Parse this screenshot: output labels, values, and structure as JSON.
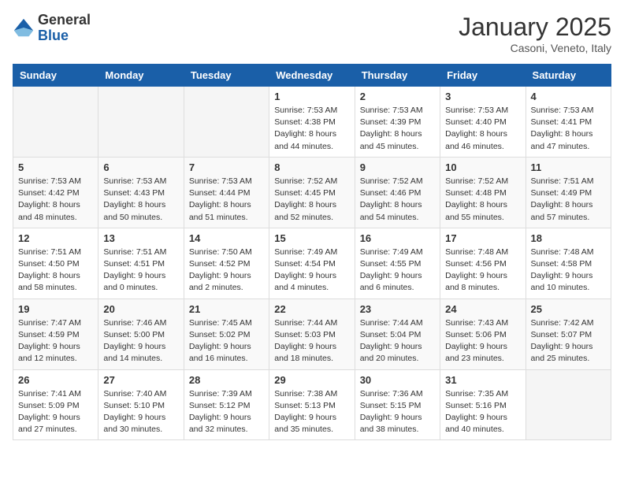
{
  "logo": {
    "general": "General",
    "blue": "Blue"
  },
  "header": {
    "month": "January 2025",
    "location": "Casoni, Veneto, Italy"
  },
  "weekdays": [
    "Sunday",
    "Monday",
    "Tuesday",
    "Wednesday",
    "Thursday",
    "Friday",
    "Saturday"
  ],
  "weeks": [
    [
      {
        "day": "",
        "sunrise": "",
        "sunset": "",
        "daylight": ""
      },
      {
        "day": "",
        "sunrise": "",
        "sunset": "",
        "daylight": ""
      },
      {
        "day": "",
        "sunrise": "",
        "sunset": "",
        "daylight": ""
      },
      {
        "day": "1",
        "sunrise": "Sunrise: 7:53 AM",
        "sunset": "Sunset: 4:38 PM",
        "daylight": "Daylight: 8 hours and 44 minutes."
      },
      {
        "day": "2",
        "sunrise": "Sunrise: 7:53 AM",
        "sunset": "Sunset: 4:39 PM",
        "daylight": "Daylight: 8 hours and 45 minutes."
      },
      {
        "day": "3",
        "sunrise": "Sunrise: 7:53 AM",
        "sunset": "Sunset: 4:40 PM",
        "daylight": "Daylight: 8 hours and 46 minutes."
      },
      {
        "day": "4",
        "sunrise": "Sunrise: 7:53 AM",
        "sunset": "Sunset: 4:41 PM",
        "daylight": "Daylight: 8 hours and 47 minutes."
      }
    ],
    [
      {
        "day": "5",
        "sunrise": "Sunrise: 7:53 AM",
        "sunset": "Sunset: 4:42 PM",
        "daylight": "Daylight: 8 hours and 48 minutes."
      },
      {
        "day": "6",
        "sunrise": "Sunrise: 7:53 AM",
        "sunset": "Sunset: 4:43 PM",
        "daylight": "Daylight: 8 hours and 50 minutes."
      },
      {
        "day": "7",
        "sunrise": "Sunrise: 7:53 AM",
        "sunset": "Sunset: 4:44 PM",
        "daylight": "Daylight: 8 hours and 51 minutes."
      },
      {
        "day": "8",
        "sunrise": "Sunrise: 7:52 AM",
        "sunset": "Sunset: 4:45 PM",
        "daylight": "Daylight: 8 hours and 52 minutes."
      },
      {
        "day": "9",
        "sunrise": "Sunrise: 7:52 AM",
        "sunset": "Sunset: 4:46 PM",
        "daylight": "Daylight: 8 hours and 54 minutes."
      },
      {
        "day": "10",
        "sunrise": "Sunrise: 7:52 AM",
        "sunset": "Sunset: 4:48 PM",
        "daylight": "Daylight: 8 hours and 55 minutes."
      },
      {
        "day": "11",
        "sunrise": "Sunrise: 7:51 AM",
        "sunset": "Sunset: 4:49 PM",
        "daylight": "Daylight: 8 hours and 57 minutes."
      }
    ],
    [
      {
        "day": "12",
        "sunrise": "Sunrise: 7:51 AM",
        "sunset": "Sunset: 4:50 PM",
        "daylight": "Daylight: 8 hours and 58 minutes."
      },
      {
        "day": "13",
        "sunrise": "Sunrise: 7:51 AM",
        "sunset": "Sunset: 4:51 PM",
        "daylight": "Daylight: 9 hours and 0 minutes."
      },
      {
        "day": "14",
        "sunrise": "Sunrise: 7:50 AM",
        "sunset": "Sunset: 4:52 PM",
        "daylight": "Daylight: 9 hours and 2 minutes."
      },
      {
        "day": "15",
        "sunrise": "Sunrise: 7:49 AM",
        "sunset": "Sunset: 4:54 PM",
        "daylight": "Daylight: 9 hours and 4 minutes."
      },
      {
        "day": "16",
        "sunrise": "Sunrise: 7:49 AM",
        "sunset": "Sunset: 4:55 PM",
        "daylight": "Daylight: 9 hours and 6 minutes."
      },
      {
        "day": "17",
        "sunrise": "Sunrise: 7:48 AM",
        "sunset": "Sunset: 4:56 PM",
        "daylight": "Daylight: 9 hours and 8 minutes."
      },
      {
        "day": "18",
        "sunrise": "Sunrise: 7:48 AM",
        "sunset": "Sunset: 4:58 PM",
        "daylight": "Daylight: 9 hours and 10 minutes."
      }
    ],
    [
      {
        "day": "19",
        "sunrise": "Sunrise: 7:47 AM",
        "sunset": "Sunset: 4:59 PM",
        "daylight": "Daylight: 9 hours and 12 minutes."
      },
      {
        "day": "20",
        "sunrise": "Sunrise: 7:46 AM",
        "sunset": "Sunset: 5:00 PM",
        "daylight": "Daylight: 9 hours and 14 minutes."
      },
      {
        "day": "21",
        "sunrise": "Sunrise: 7:45 AM",
        "sunset": "Sunset: 5:02 PM",
        "daylight": "Daylight: 9 hours and 16 minutes."
      },
      {
        "day": "22",
        "sunrise": "Sunrise: 7:44 AM",
        "sunset": "Sunset: 5:03 PM",
        "daylight": "Daylight: 9 hours and 18 minutes."
      },
      {
        "day": "23",
        "sunrise": "Sunrise: 7:44 AM",
        "sunset": "Sunset: 5:04 PM",
        "daylight": "Daylight: 9 hours and 20 minutes."
      },
      {
        "day": "24",
        "sunrise": "Sunrise: 7:43 AM",
        "sunset": "Sunset: 5:06 PM",
        "daylight": "Daylight: 9 hours and 23 minutes."
      },
      {
        "day": "25",
        "sunrise": "Sunrise: 7:42 AM",
        "sunset": "Sunset: 5:07 PM",
        "daylight": "Daylight: 9 hours and 25 minutes."
      }
    ],
    [
      {
        "day": "26",
        "sunrise": "Sunrise: 7:41 AM",
        "sunset": "Sunset: 5:09 PM",
        "daylight": "Daylight: 9 hours and 27 minutes."
      },
      {
        "day": "27",
        "sunrise": "Sunrise: 7:40 AM",
        "sunset": "Sunset: 5:10 PM",
        "daylight": "Daylight: 9 hours and 30 minutes."
      },
      {
        "day": "28",
        "sunrise": "Sunrise: 7:39 AM",
        "sunset": "Sunset: 5:12 PM",
        "daylight": "Daylight: 9 hours and 32 minutes."
      },
      {
        "day": "29",
        "sunrise": "Sunrise: 7:38 AM",
        "sunset": "Sunset: 5:13 PM",
        "daylight": "Daylight: 9 hours and 35 minutes."
      },
      {
        "day": "30",
        "sunrise": "Sunrise: 7:36 AM",
        "sunset": "Sunset: 5:15 PM",
        "daylight": "Daylight: 9 hours and 38 minutes."
      },
      {
        "day": "31",
        "sunrise": "Sunrise: 7:35 AM",
        "sunset": "Sunset: 5:16 PM",
        "daylight": "Daylight: 9 hours and 40 minutes."
      },
      {
        "day": "",
        "sunrise": "",
        "sunset": "",
        "daylight": ""
      }
    ]
  ]
}
